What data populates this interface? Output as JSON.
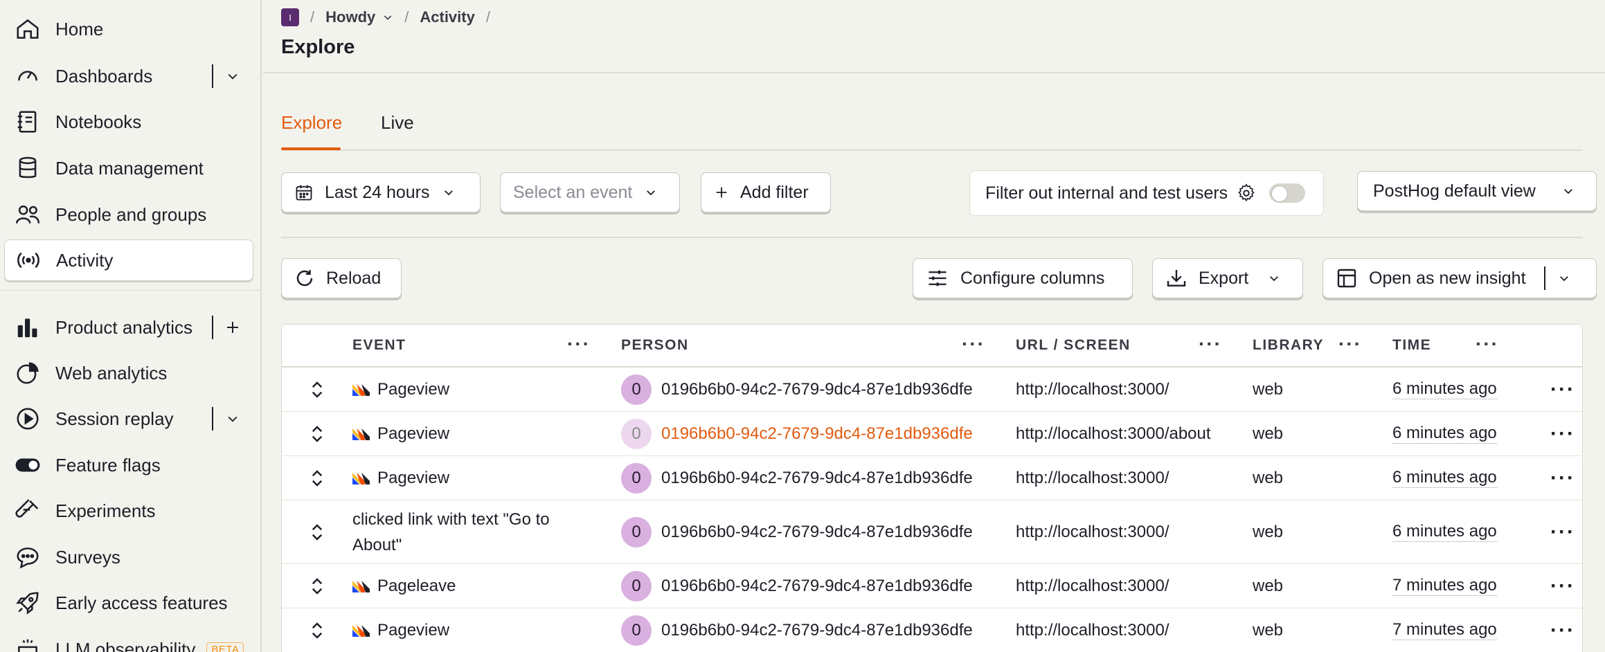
{
  "sidebar": {
    "items": [
      {
        "label": "Home",
        "icon": "home-icon"
      },
      {
        "label": "Dashboards",
        "icon": "dashboard-icon"
      },
      {
        "label": "Notebooks",
        "icon": "notebook-icon"
      },
      {
        "label": "Data management",
        "icon": "database-icon"
      },
      {
        "label": "People and groups",
        "icon": "people-icon"
      },
      {
        "label": "Activity",
        "icon": "activity-icon"
      },
      {
        "label": "Product analytics",
        "icon": "bar-chart-icon"
      },
      {
        "label": "Web analytics",
        "icon": "pie-chart-icon"
      },
      {
        "label": "Session replay",
        "icon": "play-circle-icon"
      },
      {
        "label": "Feature flags",
        "icon": "toggle-icon"
      },
      {
        "label": "Experiments",
        "icon": "flask-icon"
      },
      {
        "label": "Surveys",
        "icon": "chat-bubble-icon"
      },
      {
        "label": "Early access features",
        "icon": "rocket-icon"
      },
      {
        "label": "LLM observability",
        "icon": "llm-icon",
        "badge": "BETA"
      }
    ]
  },
  "header": {
    "project_initial": "I",
    "breadcrumbs": [
      "Howdy",
      "Activity"
    ],
    "separator": "/",
    "title": "Explore"
  },
  "tabs": [
    {
      "label": "Explore",
      "active": true
    },
    {
      "label": "Live",
      "active": false
    }
  ],
  "filters": {
    "date_range": "Last 24 hours",
    "event_placeholder": "Select an event",
    "add_filter": "Add filter",
    "internal_users_label": "Filter out internal and test users",
    "view": "PostHog default view"
  },
  "actions": {
    "reload": "Reload",
    "configure_columns": "Configure columns",
    "export": "Export",
    "open_insight": "Open as new insight"
  },
  "table": {
    "columns": [
      "EVENT",
      "PERSON",
      "URL / SCREEN",
      "LIBRARY",
      "TIME"
    ],
    "column_menu": "···",
    "rows": [
      {
        "event": "Pageview",
        "event_icon": true,
        "person_initial": "0",
        "person": "0196b6b0-94c2-7679-9dc4-87e1db936dfe",
        "url": "http://localhost:3000/",
        "library": "web",
        "time": "6 minutes ago"
      },
      {
        "event": "Pageview",
        "event_icon": true,
        "person_initial": "0",
        "person": "0196b6b0-94c2-7679-9dc4-87e1db936dfe",
        "url": "http://localhost:3000/about",
        "library": "web",
        "time": "6 minutes ago",
        "highlight": true
      },
      {
        "event": "Pageview",
        "event_icon": true,
        "person_initial": "0",
        "person": "0196b6b0-94c2-7679-9dc4-87e1db936dfe",
        "url": "http://localhost:3000/",
        "library": "web",
        "time": "6 minutes ago"
      },
      {
        "event": "clicked link with text \"Go to About\"",
        "event_icon": false,
        "person_initial": "0",
        "person": "0196b6b0-94c2-7679-9dc4-87e1db936dfe",
        "url": "http://localhost:3000/",
        "library": "web",
        "time": "6 minutes ago"
      },
      {
        "event": "Pageleave",
        "event_icon": true,
        "person_initial": "0",
        "person": "0196b6b0-94c2-7679-9dc4-87e1db936dfe",
        "url": "http://localhost:3000/",
        "library": "web",
        "time": "7 minutes ago"
      },
      {
        "event": "Pageview",
        "event_icon": true,
        "person_initial": "0",
        "person": "0196b6b0-94c2-7679-9dc4-87e1db936dfe",
        "url": "http://localhost:3000/",
        "library": "web",
        "time": "7 minutes ago"
      }
    ]
  },
  "colors": {
    "accent": "#e35b0f",
    "avatar": "#d9b0e0",
    "background": "#f3f3ee"
  }
}
